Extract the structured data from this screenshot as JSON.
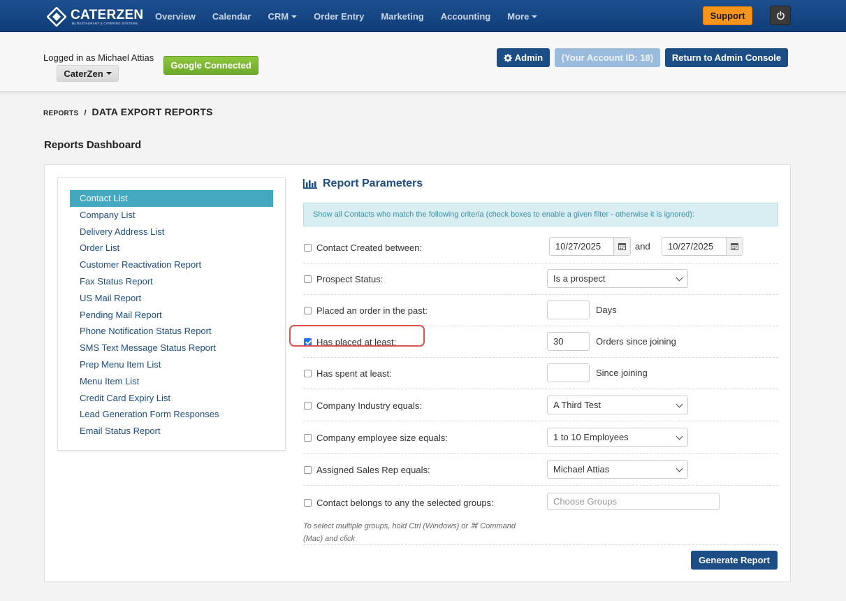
{
  "nav": {
    "logo_text": "CATERZEN",
    "logo_tag": "By RESTAURANT & CATERING SYSTEMS",
    "items": [
      "Overview",
      "Calendar",
      "CRM",
      "Order Entry",
      "Marketing",
      "Accounting",
      "More"
    ],
    "support_label": "Support",
    "brand_color": "#124382"
  },
  "account": {
    "logged_in": "Logged in as Michael Attias",
    "company": "CaterZen",
    "google": "Google Connected",
    "admin": "Admin",
    "account_id": "(Your Account ID: 18)",
    "return": "Return to Admin Console"
  },
  "breadcrumb": {
    "parent": "REPORTS",
    "sep": "/",
    "current": "DATA EXPORT REPORTS"
  },
  "page_title": "Reports Dashboard",
  "reports": [
    "Contact List",
    "Company List",
    "Delivery Address List",
    "Order List",
    "Customer Reactivation Report",
    "Fax Status Report",
    "US Mail Report",
    "Pending Mail Report",
    "Phone Notification Status Report",
    "SMS Text Message Status Report",
    "Prep Menu Item List",
    "Menu Item List",
    "Credit Card Expiry List",
    "Lead Generation Form Responses",
    "Email Status Report"
  ],
  "params": {
    "title": "Report Parameters",
    "info": "Show all Contacts who match the following criteria (check boxes to enable a given filter - otherwise it is ignored):",
    "created_label": "Contact Created between:",
    "date_from": "10/27/2025",
    "and": "and",
    "date_to": "10/27/2025",
    "prospect_label": "Prospect Status:",
    "prospect_value": "Is a prospect",
    "order_past_label": "Placed an order in the past:",
    "order_past_value": "",
    "days": "Days",
    "placed_label": "Has placed at least:",
    "placed_value": "30",
    "orders_since": "Orders since joining",
    "spent_label": "Has spent at least:",
    "spent_value": "",
    "since_joining": "Since joining",
    "industry_label": "Company Industry equals:",
    "industry_value": "A Third Test",
    "size_label": "Company employee size equals:",
    "size_value": "1 to 10 Employees",
    "rep_label": "Assigned Sales Rep equals:",
    "rep_value": "Michael Attias",
    "groups_label": "Contact belongs to any the selected groups:",
    "groups_placeholder": "Choose Groups",
    "help": "To select multiple groups, hold Ctrl (Windows) or ⌘ Command (Mac) and click",
    "generate": "Generate Report"
  }
}
